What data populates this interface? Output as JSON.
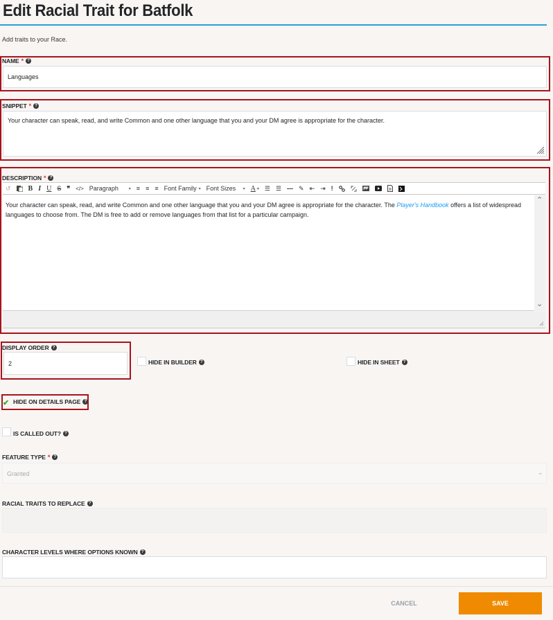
{
  "header": {
    "title": "Edit Racial Trait for Batfolk",
    "subtitle": "Add traits to your Race."
  },
  "colors": {
    "accent_rule": "#2c9fd6",
    "highlight_box": "#a8131c",
    "required": "#e0323a",
    "save_button": "#f08a00",
    "link": "#1b9af0",
    "check": "#3aa93a"
  },
  "fields": {
    "name": {
      "label": "NAME",
      "required": "*",
      "value": "Languages"
    },
    "snippet": {
      "label": "SNIPPET",
      "required": "*",
      "value": "Your character can speak, read, and write Common and one other language that you and your DM agree is appropriate for the character."
    },
    "description": {
      "label": "DESCRIPTION",
      "required": "*",
      "text_before_link": "Your character can speak, read, and write Common and one other language that you and your DM agree is appropriate for the character. The ",
      "link_text": "Player's Handbook",
      "text_after_link": " offers a list of widespread languages to choose from. The DM is free to add or remove languages from that list for a particular campaign."
    },
    "display_order": {
      "label": "DISPLAY ORDER",
      "value": "2"
    },
    "hide_in_builder": {
      "label": "HIDE IN BUILDER",
      "checked": false
    },
    "hide_in_sheet": {
      "label": "HIDE IN SHEET",
      "checked": false
    },
    "hide_on_details_page": {
      "label": "HIDE ON DETAILS PAGE",
      "checked": true
    },
    "is_called_out": {
      "label": "IS CALLED OUT?",
      "checked": false
    },
    "feature_type": {
      "label": "FEATURE TYPE",
      "required": "*",
      "selected": "Granted"
    },
    "racial_traits_to_replace": {
      "label": "RACIAL TRAITS TO REPLACE",
      "value": ""
    },
    "character_levels": {
      "label": "CHARACTER LEVELS WHERE OPTIONS KNOWN",
      "value": ""
    }
  },
  "toolbar": {
    "undo": "↺",
    "paste": "📋",
    "bold": "B",
    "italic": "I",
    "underline": "U",
    "strikethrough": "S",
    "blockquote": "❞",
    "code": "</>",
    "paragraph": "Paragraph",
    "align_left": "≡",
    "align_center": "≡",
    "align_right": "≡",
    "font_family": "Font Family",
    "font_sizes": "Font Sizes",
    "text_color": "A",
    "bullet_list": "☰",
    "numbered_list": "☰",
    "horizontal_rule": "—",
    "clear_format": "✎",
    "outdent": "⇤",
    "indent": "⇥",
    "important": "!",
    "link": "🔗",
    "unlink": "⛓",
    "image": "▣",
    "media": "▶",
    "template": "📄",
    "source": "◩",
    "caret": "▾"
  },
  "help_glyph": "?",
  "check_glyph": "✔",
  "chevron_up": "⌃",
  "chevron_down": "⌄",
  "actions": {
    "cancel": "CANCEL",
    "save": "SAVE"
  }
}
